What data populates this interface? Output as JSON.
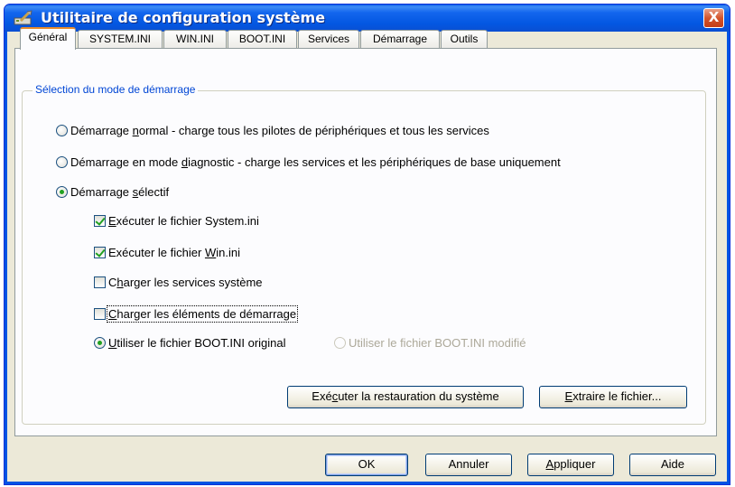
{
  "window": {
    "title": "Utilitaire de configuration système",
    "close_label": "X"
  },
  "tabs": [
    {
      "label": "Général",
      "active": true
    },
    {
      "label": "SYSTEM.INI"
    },
    {
      "label": "WIN.INI"
    },
    {
      "label": "BOOT.INI"
    },
    {
      "label": "Services"
    },
    {
      "label": "Démarrage"
    },
    {
      "label": "Outils"
    }
  ],
  "group": {
    "title": "Sélection du mode de démarrage",
    "options": {
      "normal": {
        "pre": "Démarrage ",
        "key": "n",
        "post": "ormal - charge tous les pilotes de périphériques et tous les services",
        "checked": false
      },
      "diagnostic": {
        "pre": "Démarrage en mode ",
        "key": "d",
        "post": "iagnostic - charge les services et les périphériques de base uniquement",
        "checked": false
      },
      "selective": {
        "pre": "Démarrage ",
        "key": "s",
        "post": "électif",
        "checked": true
      }
    },
    "checks": {
      "system_ini": {
        "pre": "",
        "key": "E",
        "post": "xécuter le fichier System.ini",
        "checked": true
      },
      "win_ini": {
        "pre": "Exécuter le fichier ",
        "key": "W",
        "post": "in.ini",
        "checked": true
      },
      "services": {
        "pre": "C",
        "key": "h",
        "post": "arger les services système",
        "checked": false
      },
      "startup": {
        "pre": "",
        "key": "C",
        "post": "harger les éléments de démarrage",
        "checked": false
      }
    },
    "boot": {
      "original": {
        "pre": "",
        "key": "U",
        "post": "tiliser le fichier BOOT.INI original",
        "checked": true
      },
      "modified": {
        "label": "Utiliser le fichier BOOT.INI modifié",
        "checked": false
      }
    },
    "buttons": {
      "restore": {
        "pre": "Exé",
        "key": "c",
        "post": "uter la restauration du système"
      },
      "extract": {
        "pre": "",
        "key": "E",
        "post": "xtraire le fichier..."
      }
    }
  },
  "footer": {
    "ok": "OK",
    "cancel": "Annuler",
    "apply": {
      "pre": "",
      "key": "A",
      "post": "ppliquer"
    },
    "help": "Aide"
  },
  "colors": {
    "titlebar": "#0a5de8",
    "group_title": "#0046d5",
    "check_mark": "#21a121"
  }
}
